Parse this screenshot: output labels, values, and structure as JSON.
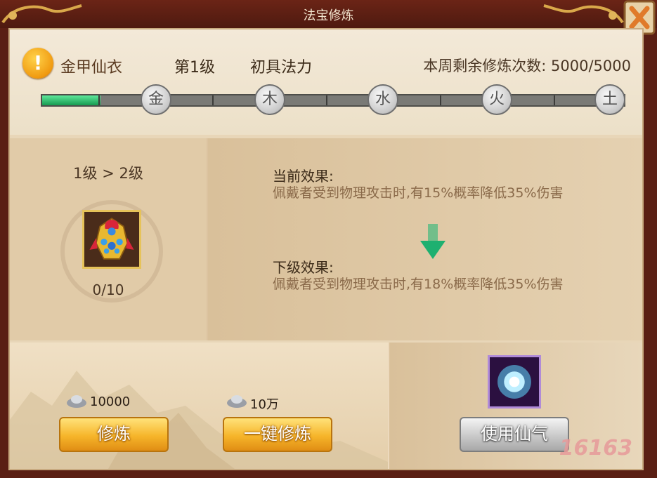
{
  "window": {
    "title": "法宝修炼"
  },
  "header": {
    "item_name": "金甲仙衣",
    "level": "第1级",
    "stage": "初具法力",
    "weekly_label": "本周剩余修炼次数:",
    "weekly_value": "5000/5000"
  },
  "progress": {
    "fill_fraction": 0.1,
    "nodes": [
      "金",
      "木",
      "水",
      "火",
      "土"
    ]
  },
  "detail": {
    "level_change": "1级 > 2级",
    "item_progress": "0/10",
    "current_title": "当前效果:",
    "current_text": "佩戴者受到物理攻击时,有15%概率降低35%伤害",
    "next_title": "下级效果:",
    "next_text": "佩戴者受到物理攻击时,有18%概率降低35%伤害"
  },
  "actions": {
    "train_cost": "10000",
    "train_label": "修炼",
    "oneclick_cost": "10万",
    "oneclick_label": "一键修炼",
    "use_label": "使用仙气"
  },
  "watermark": "16163",
  "icons": [
    "warning-icon",
    "close-icon",
    "silver-ingot-icon",
    "down-arrow-icon",
    "armor-item-icon",
    "spirit-orb-icon"
  ]
}
